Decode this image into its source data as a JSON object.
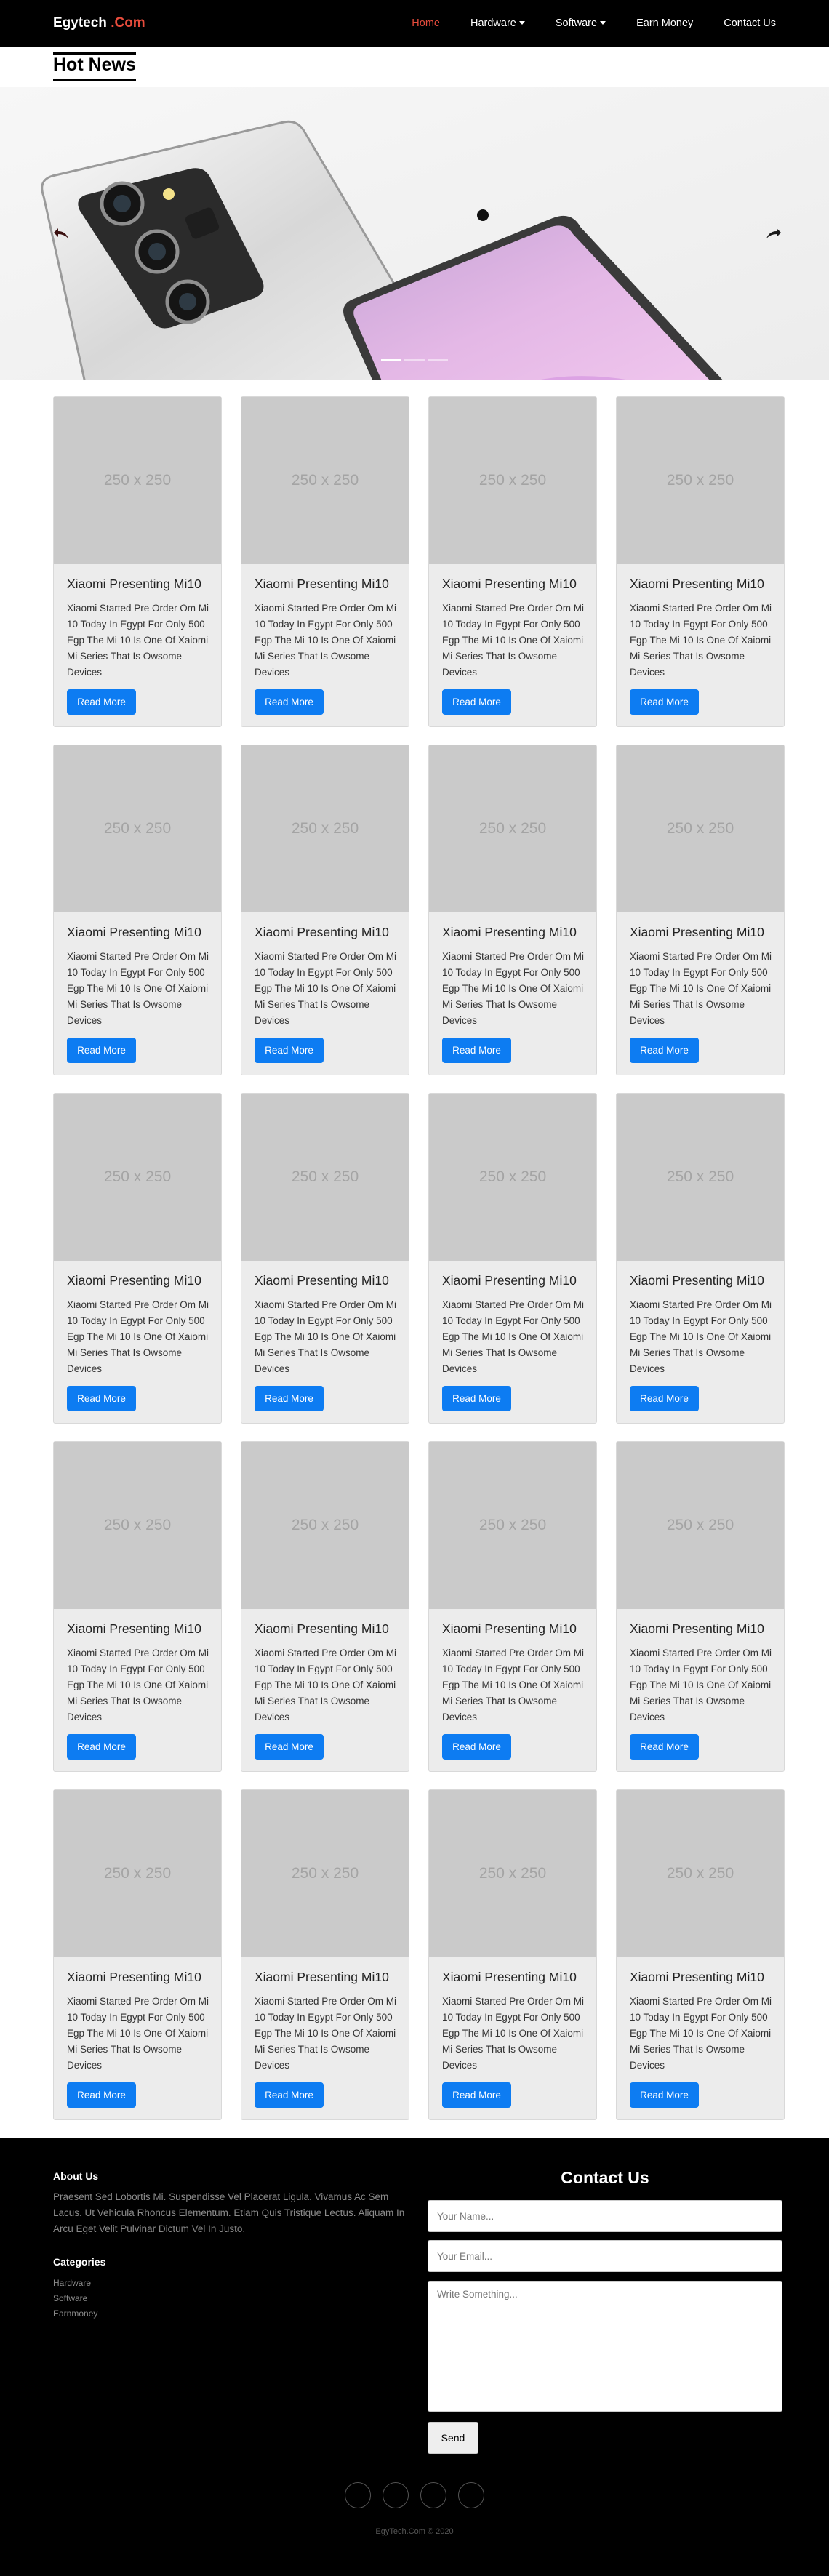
{
  "navbar": {
    "brand_main": "Egytech",
    "brand_accent": ".Com",
    "items": [
      {
        "label": "Home",
        "active": true
      },
      {
        "label": "Hardware",
        "dropdown": true
      },
      {
        "label": "Software",
        "dropdown": true
      },
      {
        "label": "Earn Money"
      },
      {
        "label": "Contact Us"
      }
    ]
  },
  "section_title": "Hot News",
  "carousel": {
    "prev_icon": "left-arrow-icon",
    "next_icon": "right-arrow-icon",
    "slide_count": 3,
    "active_slide": 1
  },
  "cards": [
    {
      "image_text": "250 x 250",
      "title": "Xiaomi Presenting Mi10",
      "text": "Xiaomi Started Pre Order Om Mi 10 Today In Egypt For Only 500 Egp The Mi 10 Is One Of Xaiomi Mi Series That Is Owsome Devices",
      "button": "Read More"
    },
    {
      "image_text": "250 x 250",
      "title": "Xiaomi Presenting Mi10",
      "text": "Xiaomi Started Pre Order Om Mi 10 Today In Egypt For Only 500 Egp The Mi 10 Is One Of Xaiomi Mi Series That Is Owsome Devices",
      "button": "Read More"
    },
    {
      "image_text": "250 x 250",
      "title": "Xiaomi Presenting Mi10",
      "text": "Xiaomi Started Pre Order Om Mi 10 Today In Egypt For Only 500 Egp The Mi 10 Is One Of Xaiomi Mi Series That Is Owsome Devices",
      "button": "Read More"
    },
    {
      "image_text": "250 x 250",
      "title": "Xiaomi Presenting Mi10",
      "text": "Xiaomi Started Pre Order Om Mi 10 Today In Egypt For Only 500 Egp The Mi 10 Is One Of Xaiomi Mi Series That Is Owsome Devices",
      "button": "Read More"
    },
    {
      "image_text": "250 x 250",
      "title": "Xiaomi Presenting Mi10",
      "text": "Xiaomi Started Pre Order Om Mi 10 Today In Egypt For Only 500 Egp The Mi 10 Is One Of Xaiomi Mi Series That Is Owsome Devices",
      "button": "Read More"
    },
    {
      "image_text": "250 x 250",
      "title": "Xiaomi Presenting Mi10",
      "text": "Xiaomi Started Pre Order Om Mi 10 Today In Egypt For Only 500 Egp The Mi 10 Is One Of Xaiomi Mi Series That Is Owsome Devices",
      "button": "Read More"
    },
    {
      "image_text": "250 x 250",
      "title": "Xiaomi Presenting Mi10",
      "text": "Xiaomi Started Pre Order Om Mi 10 Today In Egypt For Only 500 Egp The Mi 10 Is One Of Xaiomi Mi Series That Is Owsome Devices",
      "button": "Read More"
    },
    {
      "image_text": "250 x 250",
      "title": "Xiaomi Presenting Mi10",
      "text": "Xiaomi Started Pre Order Om Mi 10 Today In Egypt For Only 500 Egp The Mi 10 Is One Of Xaiomi Mi Series That Is Owsome Devices",
      "button": "Read More"
    },
    {
      "image_text": "250 x 250",
      "title": "Xiaomi Presenting Mi10",
      "text": "Xiaomi Started Pre Order Om Mi 10 Today In Egypt For Only 500 Egp The Mi 10 Is One Of Xaiomi Mi Series That Is Owsome Devices",
      "button": "Read More"
    },
    {
      "image_text": "250 x 250",
      "title": "Xiaomi Presenting Mi10",
      "text": "Xiaomi Started Pre Order Om Mi 10 Today In Egypt For Only 500 Egp The Mi 10 Is One Of Xaiomi Mi Series That Is Owsome Devices",
      "button": "Read More"
    },
    {
      "image_text": "250 x 250",
      "title": "Xiaomi Presenting Mi10",
      "text": "Xiaomi Started Pre Order Om Mi 10 Today In Egypt For Only 500 Egp The Mi 10 Is One Of Xaiomi Mi Series That Is Owsome Devices",
      "button": "Read More"
    },
    {
      "image_text": "250 x 250",
      "title": "Xiaomi Presenting Mi10",
      "text": "Xiaomi Started Pre Order Om Mi 10 Today In Egypt For Only 500 Egp The Mi 10 Is One Of Xaiomi Mi Series That Is Owsome Devices",
      "button": "Read More"
    },
    {
      "image_text": "250 x 250",
      "title": "Xiaomi Presenting Mi10",
      "text": "Xiaomi Started Pre Order Om Mi 10 Today In Egypt For Only 500 Egp The Mi 10 Is One Of Xaiomi Mi Series That Is Owsome Devices",
      "button": "Read More"
    },
    {
      "image_text": "250 x 250",
      "title": "Xiaomi Presenting Mi10",
      "text": "Xiaomi Started Pre Order Om Mi 10 Today In Egypt For Only 500 Egp The Mi 10 Is One Of Xaiomi Mi Series That Is Owsome Devices",
      "button": "Read More"
    },
    {
      "image_text": "250 x 250",
      "title": "Xiaomi Presenting Mi10",
      "text": "Xiaomi Started Pre Order Om Mi 10 Today In Egypt For Only 500 Egp The Mi 10 Is One Of Xaiomi Mi Series That Is Owsome Devices",
      "button": "Read More"
    },
    {
      "image_text": "250 x 250",
      "title": "Xiaomi Presenting Mi10",
      "text": "Xiaomi Started Pre Order Om Mi 10 Today In Egypt For Only 500 Egp The Mi 10 Is One Of Xaiomi Mi Series That Is Owsome Devices",
      "button": "Read More"
    },
    {
      "image_text": "250 x 250",
      "title": "Xiaomi Presenting Mi10",
      "text": "Xiaomi Started Pre Order Om Mi 10 Today In Egypt For Only 500 Egp The Mi 10 Is One Of Xaiomi Mi Series That Is Owsome Devices",
      "button": "Read More"
    },
    {
      "image_text": "250 x 250",
      "title": "Xiaomi Presenting Mi10",
      "text": "Xiaomi Started Pre Order Om Mi 10 Today In Egypt For Only 500 Egp The Mi 10 Is One Of Xaiomi Mi Series That Is Owsome Devices",
      "button": "Read More"
    },
    {
      "image_text": "250 x 250",
      "title": "Xiaomi Presenting Mi10",
      "text": "Xiaomi Started Pre Order Om Mi 10 Today In Egypt For Only 500 Egp The Mi 10 Is One Of Xaiomi Mi Series That Is Owsome Devices",
      "button": "Read More"
    },
    {
      "image_text": "250 x 250",
      "title": "Xiaomi Presenting Mi10",
      "text": "Xiaomi Started Pre Order Om Mi 10 Today In Egypt For Only 500 Egp The Mi 10 Is One Of Xaiomi Mi Series That Is Owsome Devices",
      "button": "Read More"
    }
  ],
  "footer": {
    "about_title": "About Us",
    "about_text": "Praesent Sed Lobortis Mi. Suspendisse Vel Placerat Ligula. Vivamus Ac Sem Lacus. Ut Vehicula Rhoncus Elementum. Etiam Quis Tristique Lectus. Aliquam In Arcu Eget Velit Pulvinar Dictum Vel In Justo.",
    "categories_title": "Categories",
    "categories": [
      "Hardware",
      "Software",
      "Earnmoney"
    ],
    "contact_title": "Contact Us",
    "name_placeholder": "Your Name...",
    "email_placeholder": "Your Email...",
    "message_placeholder": "Write Something...",
    "send_label": "Send",
    "social_icons": [
      "social-icon-1",
      "social-icon-2",
      "social-icon-3",
      "social-icon-4"
    ],
    "copyright": "EgyTech.Com © 2020"
  },
  "colors": {
    "accent": "#e74c3c",
    "button": "#0d7cf2",
    "navbar": "#000000"
  }
}
